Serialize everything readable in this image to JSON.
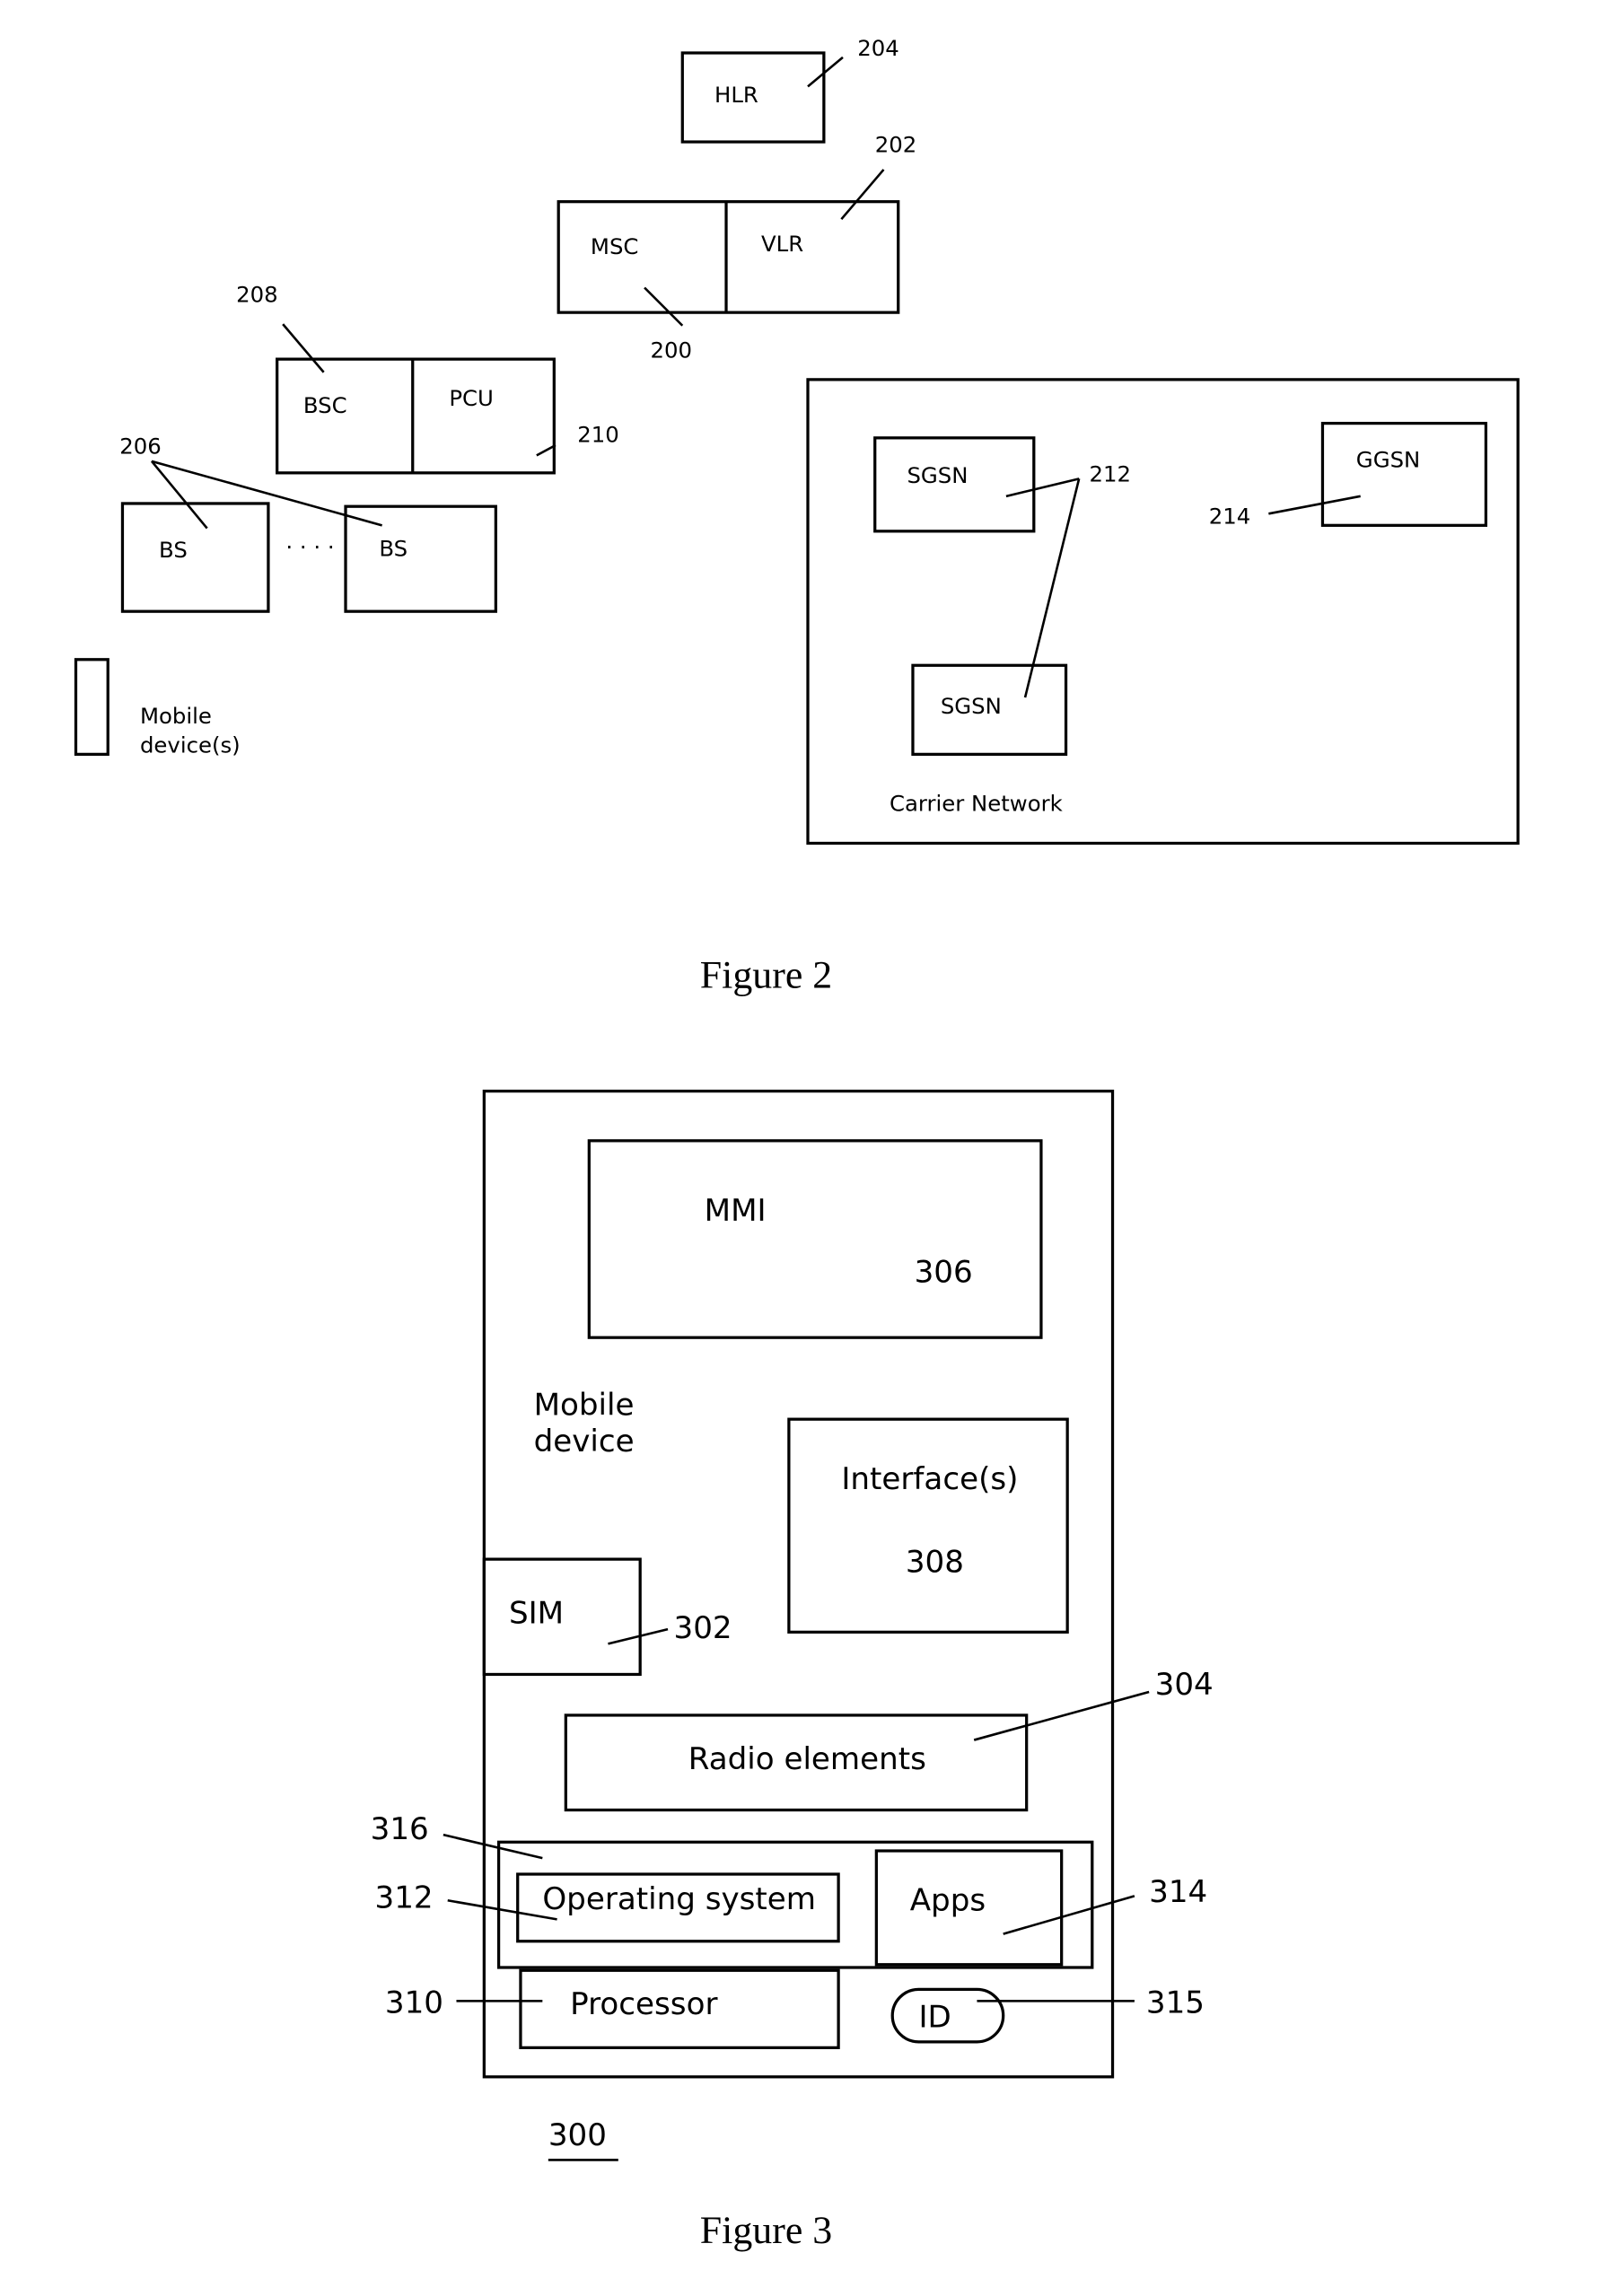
{
  "figure2": {
    "caption": "Figure 2",
    "nodes": {
      "hlr": "HLR",
      "msc": "MSC",
      "vlr": "VLR",
      "bsc": "BSC",
      "pcu": "PCU",
      "bs1": "BS",
      "bs2": "BS",
      "bs_ellipsis": "· · · ·",
      "sgsn1": "SGSN",
      "sgsn2": "SGSN",
      "ggsn": "GGSN",
      "mobile_device_line1": "Mobile",
      "mobile_device_line2": "device(s)",
      "carrier_network": "Carrier Network"
    },
    "refs": {
      "msc": "200",
      "vlr": "202",
      "hlr": "204",
      "bs": "206",
      "bsc": "208",
      "pcu": "210",
      "sgsn": "212",
      "ggsn": "214"
    }
  },
  "figure3": {
    "caption": "Figure 3",
    "figure_ref": "300",
    "nodes": {
      "mobile_device_line1": "Mobile",
      "mobile_device_line2": "device",
      "mmi": "MMI",
      "interfaces": "Interface(s)",
      "sim": "SIM",
      "radio": "Radio elements",
      "os": "Operating system",
      "apps": "Apps",
      "processor": "Processor",
      "id": "ID"
    },
    "refs": {
      "sim": "302",
      "radio": "304",
      "mmi": "306",
      "interfaces": "308",
      "processor": "310",
      "os": "312",
      "apps": "314",
      "id": "315",
      "software": "316"
    }
  }
}
